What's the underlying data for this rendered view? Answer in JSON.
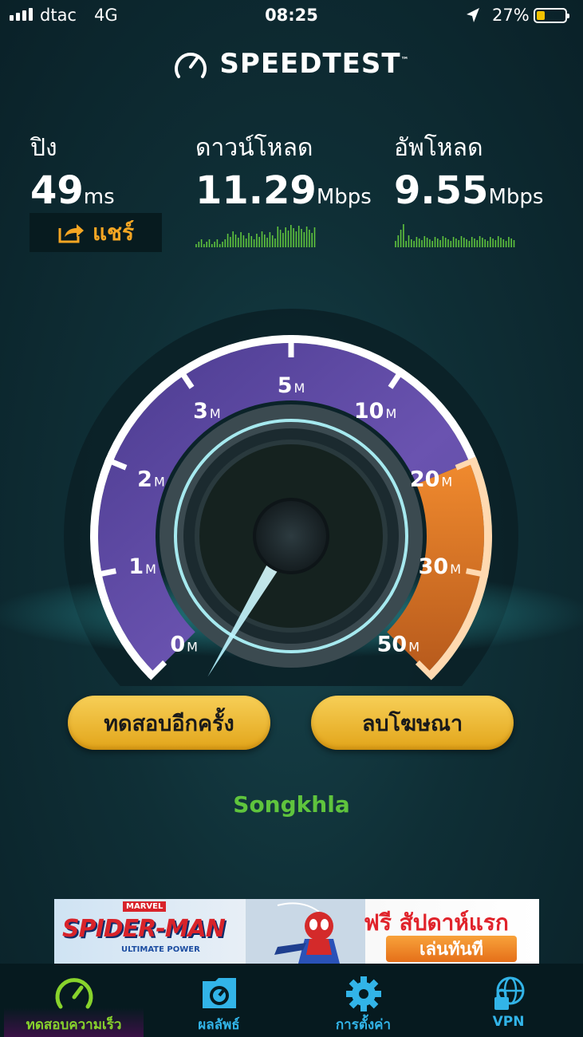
{
  "status_bar": {
    "carrier": "dtac",
    "network": "4G",
    "time": "08:25",
    "battery_percent": "27%",
    "battery_level": 0.27
  },
  "header": {
    "brand": "SPEEDTEST",
    "trademark": "™",
    "icon": "speedometer-icon"
  },
  "metrics": {
    "ping": {
      "label": "ปิง",
      "value": "49",
      "unit": "ms"
    },
    "download": {
      "label": "ดาวน์โหลด",
      "value": "11.29",
      "unit": "Mbps"
    },
    "upload": {
      "label": "อัพโหลด",
      "value": "9.55",
      "unit": "Mbps"
    }
  },
  "share": {
    "label": "แชร์",
    "icon": "share-icon"
  },
  "gauge": {
    "ticks": [
      {
        "num": "0",
        "unit": "M"
      },
      {
        "num": "1",
        "unit": "M"
      },
      {
        "num": "2",
        "unit": "M"
      },
      {
        "num": "3",
        "unit": "M"
      },
      {
        "num": "5",
        "unit": "M"
      },
      {
        "num": "10",
        "unit": "M"
      },
      {
        "num": "20",
        "unit": "M"
      },
      {
        "num": "30",
        "unit": "M"
      },
      {
        "num": "50",
        "unit": "M"
      }
    ],
    "needle_value_mbps": 0
  },
  "buttons": {
    "test_again": "ทดสอบอีกครั้ง",
    "remove_ads": "ลบโฆษณา"
  },
  "location": "Songkhla",
  "ad": {
    "brand_badge": "MARVEL",
    "title": "SPIDER-MAN",
    "subtitle": "ULTIMATE POWER",
    "promo": "ฟรี สัปดาห์แรก",
    "cta": "เล่นทันที"
  },
  "tabs": [
    {
      "label": "ทดสอบความเร็ว",
      "icon": "speedometer-icon",
      "active": true
    },
    {
      "label": "ผลลัพธ์",
      "icon": "results-folder-icon",
      "active": false
    },
    {
      "label": "การตั้งค่า",
      "icon": "gear-icon",
      "active": false
    },
    {
      "label": "VPN",
      "icon": "vpn-globe-lock-icon",
      "active": false
    }
  ],
  "colors": {
    "accent_green": "#5fc43d",
    "tab_blue": "#32b4e8",
    "button_gold": "#e9b23a",
    "gauge_purple": "#6b4fa8",
    "gauge_orange": "#e07a2a",
    "active_tab_green": "#88d32c"
  }
}
